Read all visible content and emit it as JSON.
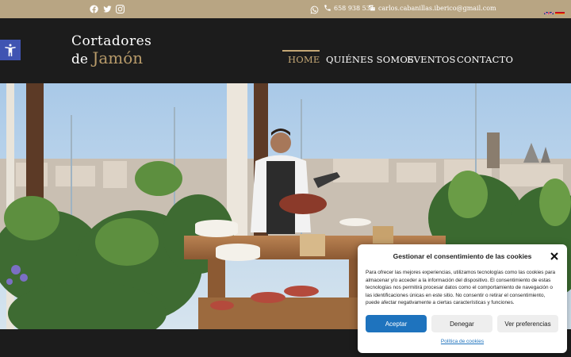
{
  "topbar": {
    "social": [
      {
        "icon": "facebook-icon"
      },
      {
        "icon": "twitter-icon"
      },
      {
        "icon": "instagram-icon"
      }
    ],
    "whatsapp_icon": "whatsapp-icon",
    "phone": "658 938 531",
    "email": "carlos.cabanillas.iberico@gmail.com",
    "languages": [
      "en",
      "es"
    ]
  },
  "logo": {
    "line1": "Cortadores",
    "line2_prefix": "de",
    "line2_accent": "Jamón"
  },
  "nav": {
    "items": [
      {
        "label": "HOME",
        "active": true
      },
      {
        "label": "QUIÉNES SOMOS",
        "active": false
      },
      {
        "label": "EVENTOS",
        "active": false
      },
      {
        "label": "CONTACTO",
        "active": false
      }
    ]
  },
  "accessibility": {
    "icon": "accessibility-icon"
  },
  "cookie": {
    "title": "Gestionar el consentimiento de las cookies",
    "text": "Para ofrecer las mejores experiencias, utilizamos tecnologías como las cookies para almacenar y/o acceder a la información del dispositivo. El consentimiento de estas tecnologías nos permitirá procesar datos como el comportamiento de navegación o las identificaciones únicas en este sitio. No consentir o retirar el consentimiento, puede afectar negativamente a ciertas características y funciones.",
    "accept": "Aceptar",
    "deny": "Denegar",
    "prefs": "Ver preferencias",
    "policy": "Política de cookies"
  },
  "colors": {
    "topbar": "#b8a583",
    "accent": "#c4a775",
    "dark": "#1c1c1c",
    "accept_button": "#1e73be",
    "accessibility": "#4054b2"
  }
}
